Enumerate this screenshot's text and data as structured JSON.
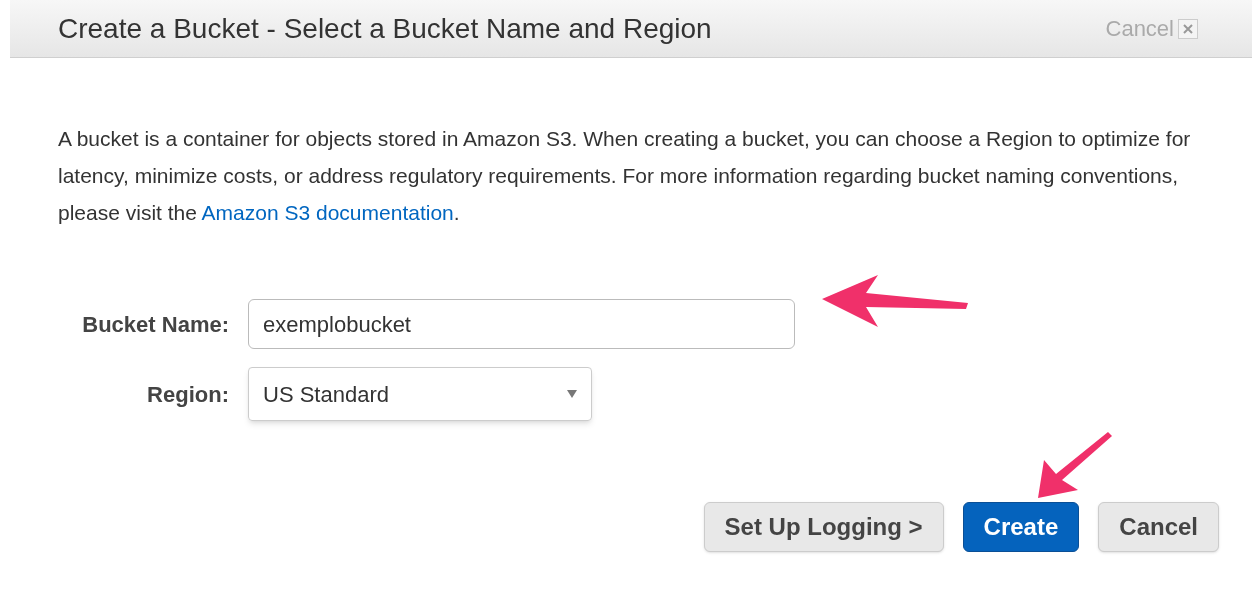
{
  "dialog": {
    "title": "Create a Bucket - Select a Bucket Name and Region",
    "header_cancel": "Cancel"
  },
  "description": {
    "text": "A bucket is a container for objects stored in Amazon S3. When creating a bucket, you can choose a Region to optimize for latency, minimize costs, or address regulatory requirements. For more information regarding bucket naming conventions, please visit the",
    "link": "Amazon S3 documentation",
    "after": "."
  },
  "fields": [
    {
      "kind": "text",
      "label": "Bucket Name:",
      "value": "exemplobucket"
    },
    {
      "kind": "select",
      "label": "Region:",
      "value": "US Standard"
    }
  ],
  "buttons": [
    {
      "kind": "secondary",
      "label": "Set Up Logging >"
    },
    {
      "kind": "primary",
      "label": "Create"
    },
    {
      "kind": "secondary",
      "label": "Cancel"
    }
  ]
}
